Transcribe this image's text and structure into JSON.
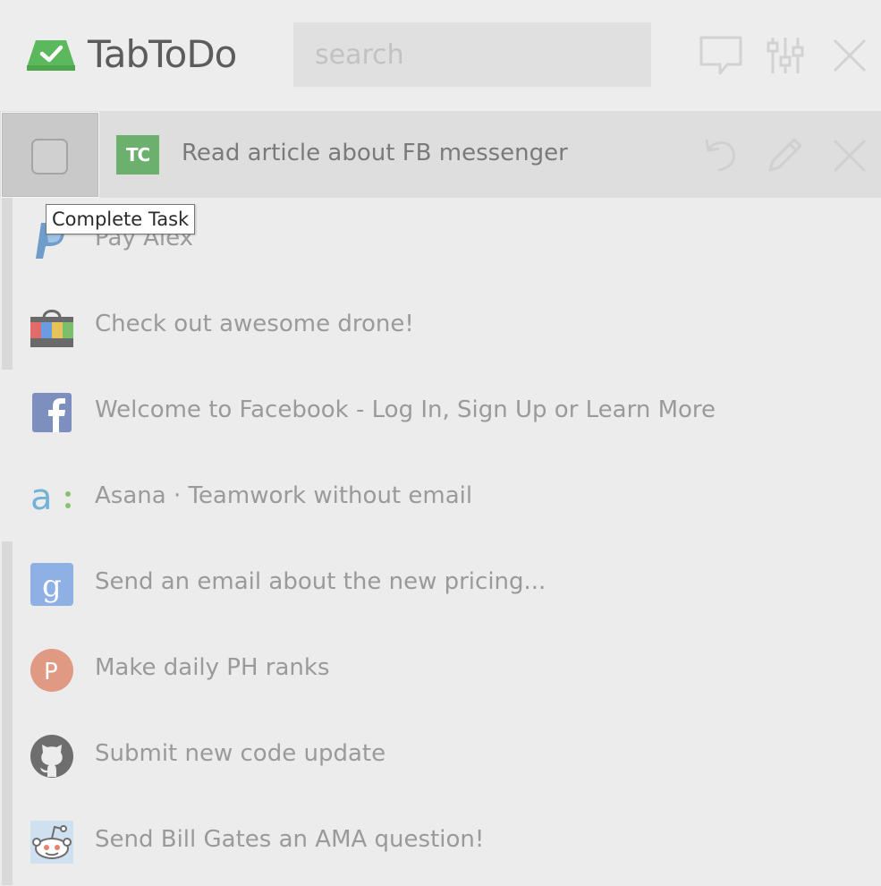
{
  "app": {
    "title": "TabToDo"
  },
  "search": {
    "placeholder": "search"
  },
  "header_icons": [
    "feedback-icon",
    "settings-sliders-icon",
    "close-icon"
  ],
  "active_task": {
    "label": "Read article about FB messenger",
    "site_icon": "techcrunch-icon",
    "site_text": "TC",
    "actions": [
      "undo-icon",
      "edit-icon",
      "delete-icon"
    ]
  },
  "tooltip": {
    "text": "Complete Task"
  },
  "tasks": [
    {
      "label": "Pay Alex",
      "icon": "paypal-icon"
    },
    {
      "label": "Check out awesome drone!",
      "icon": "shopping-bag-icon"
    },
    {
      "label": "Welcome to Facebook - Log In, Sign Up or Learn More",
      "icon": "facebook-icon"
    },
    {
      "label": "Asana · Teamwork without email",
      "icon": "asana-icon"
    },
    {
      "label": "Send an email about the new pricing...",
      "icon": "google-icon"
    },
    {
      "label": "Make daily PH ranks",
      "icon": "producthunt-icon"
    },
    {
      "label": "Submit new code update",
      "icon": "github-icon"
    },
    {
      "label": "Send Bill Gates an AMA question!",
      "icon": "reddit-icon"
    }
  ],
  "colors": {
    "brand_green": "#5cb85c",
    "background": "#ececec",
    "active_row": "#dedede"
  }
}
